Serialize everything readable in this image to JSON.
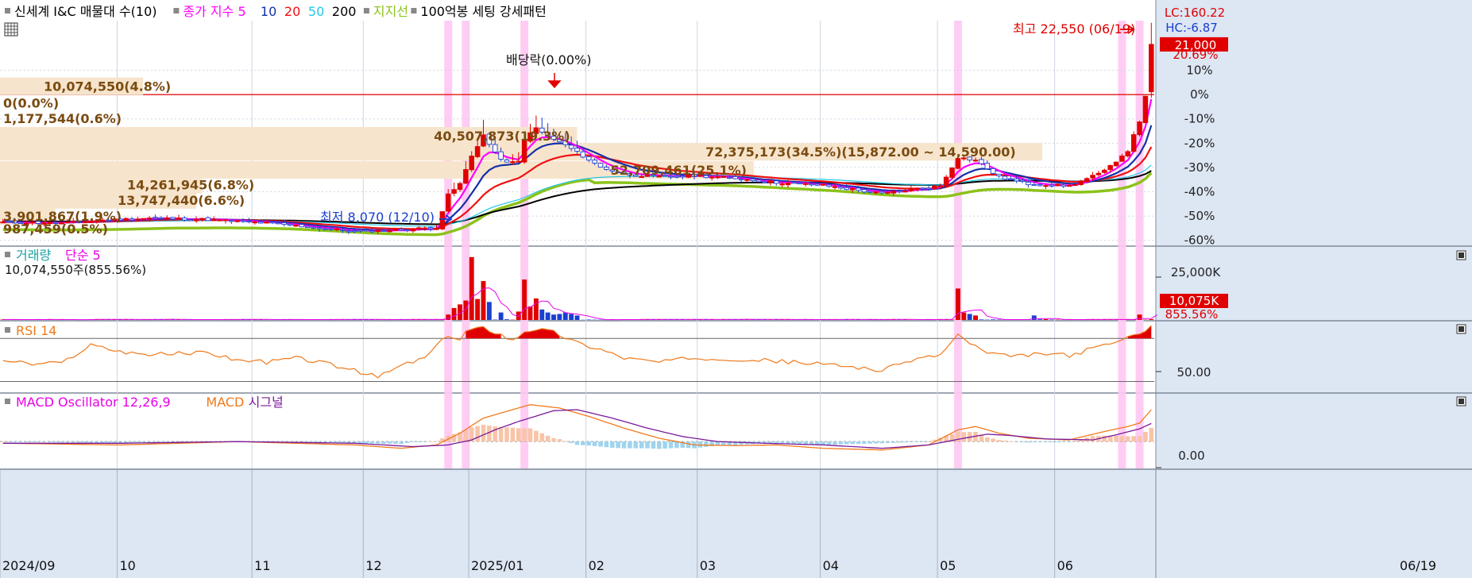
{
  "colors": {
    "background": "#ffffff",
    "axis_panel": "#dde6f3",
    "grid": "#cfd6e2",
    "up": "#e00000",
    "down": "#1a3fd1",
    "ma5": "#ff00ff",
    "ma10": "#1530a8",
    "ma20": "#ee1111",
    "ma50": "#22c8e8",
    "ma200": "#000000",
    "support": "#8cc21a",
    "highlight": "#ffc8f2",
    "band": "#f7e4cc",
    "annotation": "#7a4b10",
    "volume_ma": "#e800e8",
    "rsi": "#f0791a",
    "macd": "#f0791a",
    "signal": "#7a1a9a",
    "osc_pos": "#f8c4a8",
    "osc_neg": "#9fd4ee"
  },
  "header": {
    "grid_icon": "grid-icon",
    "items": [
      {
        "text": "신세계 I&C 매물대 수(10)",
        "color": "#000000"
      },
      {
        "text": "종가 지수 5",
        "color": "#ff00ff"
      },
      {
        "text": "10",
        "color": "#1530a8"
      },
      {
        "text": "20",
        "color": "#ee1111"
      },
      {
        "text": "50",
        "color": "#22c8e8"
      },
      {
        "text": "200",
        "color": "#000000"
      },
      {
        "text": "지지선",
        "color": "#8cc21a"
      },
      {
        "text": "100억봉 세팅 강세패턴",
        "color": "#000000"
      }
    ]
  },
  "price_panel": {
    "lc_label": "LC:160.22",
    "hc_label": "HC:-6.87",
    "current_price_label": "21,000",
    "current_change_label": "20.69%",
    "high_label": "최고 22,550 (06/19)",
    "low_label": "최저 8,070 (12/10)",
    "dividend_label": "배당락(0.00%)",
    "y_ticks": [
      "10%",
      "0%",
      "-10%",
      "-20%",
      "-30%",
      "-40%",
      "-50%",
      "-60%"
    ]
  },
  "volume_profile": [
    {
      "label": "10,074,550(4.8%)",
      "price": 18.0,
      "width": 0.124
    },
    {
      "label": "0(0.0%)",
      "price": 16.8,
      "width": 0.0
    },
    {
      "label": "1,177,544(0.6%)",
      "price": 15.7,
      "width": 0.0
    },
    {
      "label": "40,507,873(19.3%)",
      "price": 14.45,
      "width": 0.5
    },
    {
      "label": "72,375,173(34.5%)(15,872.00 ~ 14,590.00)",
      "price": 13.3,
      "width": 0.903
    },
    {
      "label": "52,709,461(25.1%)",
      "price": 12.0,
      "width": 0.653
    },
    {
      "label": "14,261,945(6.8%)",
      "price": 10.95,
      "width": 0.175
    },
    {
      "label": "13,747,440(6.6%)",
      "price": 9.85,
      "width": 0.17
    },
    {
      "label": "3,901,867(1.9%)",
      "price": 8.7,
      "width": 0.048
    },
    {
      "label": "987,459(0.5%)",
      "price": 7.8,
      "width": 0.0
    }
  ],
  "volume_panel": {
    "legend": [
      {
        "text": "거래량",
        "color": "#1aa0a0"
      },
      {
        "text": "단순 5",
        "color": "#e800e8"
      }
    ],
    "info": "10,074,550주(855.56%)",
    "y_tick": "25,000K",
    "current_label": "10,075K",
    "current_pct": "855.56%"
  },
  "rsi_panel": {
    "legend": [
      {
        "text": "RSI 14",
        "color": "#f0791a"
      }
    ],
    "y_tick": "50.00"
  },
  "macd_panel": {
    "legend": [
      {
        "text": "MACD Oscillator 12,26,9",
        "color": "#e800e8"
      },
      {
        "text": "MACD",
        "color": "#f0791a"
      },
      {
        "text": "시그널",
        "color": "#7a1a9a"
      }
    ],
    "y_tick": "0.00"
  },
  "x_axis": {
    "labels": [
      "2024/09",
      "10",
      "11",
      "12",
      "2025/01",
      "02",
      "03",
      "04",
      "05",
      "06"
    ],
    "month_starts": [
      0,
      20,
      43,
      62,
      80,
      100,
      119,
      140,
      160,
      180
    ],
    "right_label": "06/19"
  },
  "chart_data": {
    "type": "candlestick",
    "title": "신세계 I&C",
    "bars": 197,
    "price_range": [
      6.6,
      22.7
    ],
    "base_price": 17.4,
    "last_close": 21000,
    "high": {
      "value": 22550,
      "date": "06/19"
    },
    "low": {
      "value": 8070,
      "date": "12/10"
    },
    "highlight_bars": [
      76,
      79,
      89,
      163,
      191,
      194
    ],
    "price_keypoints": [
      [
        0,
        8.25
      ],
      [
        10,
        8.2
      ],
      [
        17,
        8.4
      ],
      [
        25,
        8.55
      ],
      [
        35,
        8.45
      ],
      [
        45,
        8.2
      ],
      [
        55,
        7.8
      ],
      [
        60,
        7.6
      ],
      [
        68,
        7.7
      ],
      [
        74,
        7.9
      ],
      [
        76,
        10.2
      ],
      [
        78,
        11.0
      ],
      [
        80,
        13.0
      ],
      [
        82,
        14.5
      ],
      [
        84,
        13.2
      ],
      [
        86,
        12.5
      ],
      [
        88,
        12.6
      ],
      [
        89,
        14.2
      ],
      [
        91,
        15.0
      ],
      [
        93,
        14.4
      ],
      [
        96,
        13.8
      ],
      [
        99,
        13.0
      ],
      [
        102,
        12.2
      ],
      [
        106,
        11.7
      ],
      [
        112,
        11.5
      ],
      [
        118,
        11.6
      ],
      [
        125,
        11.4
      ],
      [
        132,
        11.1
      ],
      [
        140,
        10.9
      ],
      [
        150,
        10.3
      ],
      [
        155,
        10.6
      ],
      [
        160,
        10.85
      ],
      [
        163,
        12.9
      ],
      [
        166,
        12.7
      ],
      [
        170,
        11.5
      ],
      [
        175,
        11.0
      ],
      [
        182,
        10.85
      ],
      [
        188,
        11.9
      ],
      [
        192,
        13.4
      ],
      [
        194,
        15.5
      ],
      [
        197,
        21.0
      ]
    ],
    "volume_spikes": [
      [
        76,
        1800
      ],
      [
        77,
        4000
      ],
      [
        78,
        5200
      ],
      [
        79,
        6500
      ],
      [
        80,
        21000
      ],
      [
        81,
        7000
      ],
      [
        82,
        13000
      ],
      [
        83,
        6000
      ],
      [
        85,
        2500
      ],
      [
        88,
        2800
      ],
      [
        89,
        13500
      ],
      [
        90,
        4500
      ],
      [
        91,
        7200
      ],
      [
        92,
        3500
      ],
      [
        93,
        2500
      ],
      [
        94,
        1800
      ],
      [
        95,
        2000
      ],
      [
        96,
        2500
      ],
      [
        97,
        2000
      ],
      [
        98,
        1500
      ],
      [
        163,
        10500
      ],
      [
        164,
        2500
      ],
      [
        165,
        2000
      ],
      [
        166,
        1500
      ],
      [
        176,
        1500
      ],
      [
        194,
        1800
      ],
      [
        197,
        6000
      ]
    ],
    "volume_range": [
      0,
      22000
    ],
    "rsi_range": [
      20,
      85
    ],
    "rsi_keypoints": [
      [
        0,
        50
      ],
      [
        5,
        46
      ],
      [
        10,
        47
      ],
      [
        15,
        64
      ],
      [
        20,
        58
      ],
      [
        25,
        55
      ],
      [
        30,
        56
      ],
      [
        35,
        57
      ],
      [
        40,
        50
      ],
      [
        45,
        48
      ],
      [
        50,
        52
      ],
      [
        55,
        47
      ],
      [
        60,
        40
      ],
      [
        64,
        34
      ],
      [
        68,
        45
      ],
      [
        72,
        52
      ],
      [
        76,
        73
      ],
      [
        78,
        68
      ],
      [
        79,
        77
      ],
      [
        82,
        80
      ],
      [
        85,
        74
      ],
      [
        87,
        68
      ],
      [
        89,
        77
      ],
      [
        91,
        79
      ],
      [
        94,
        76
      ],
      [
        98,
        66
      ],
      [
        102,
        60
      ],
      [
        106,
        52
      ],
      [
        112,
        48
      ],
      [
        118,
        52
      ],
      [
        125,
        51
      ],
      [
        132,
        49
      ],
      [
        140,
        46
      ],
      [
        145,
        44
      ],
      [
        150,
        40
      ],
      [
        155,
        50
      ],
      [
        160,
        55
      ],
      [
        163,
        73
      ],
      [
        165,
        66
      ],
      [
        168,
        56
      ],
      [
        172,
        53
      ],
      [
        178,
        56
      ],
      [
        182,
        54
      ],
      [
        188,
        64
      ],
      [
        192,
        70
      ],
      [
        194,
        76
      ],
      [
        197,
        84
      ]
    ],
    "macd_range": [
      -0.8,
      1.4
    ],
    "macd_keypoints": [
      [
        0,
        -0.05
      ],
      [
        20,
        -0.1
      ],
      [
        40,
        0.0
      ],
      [
        60,
        -0.1
      ],
      [
        68,
        -0.2
      ],
      [
        74,
        -0.1
      ],
      [
        78,
        0.25
      ],
      [
        82,
        0.7
      ],
      [
        86,
        0.9
      ],
      [
        90,
        1.1
      ],
      [
        95,
        1.0
      ],
      [
        100,
        0.75
      ],
      [
        106,
        0.4
      ],
      [
        112,
        0.1
      ],
      [
        118,
        -0.1
      ],
      [
        125,
        -0.12
      ],
      [
        132,
        -0.1
      ],
      [
        140,
        -0.2
      ],
      [
        150,
        -0.25
      ],
      [
        158,
        -0.1
      ],
      [
        163,
        0.35
      ],
      [
        166,
        0.45
      ],
      [
        170,
        0.25
      ],
      [
        175,
        0.1
      ],
      [
        182,
        0.05
      ],
      [
        188,
        0.3
      ],
      [
        192,
        0.45
      ],
      [
        194,
        0.55
      ],
      [
        197,
        1.15
      ]
    ],
    "signal_keypoints": [
      [
        0,
        -0.05
      ],
      [
        20,
        -0.05
      ],
      [
        40,
        0.0
      ],
      [
        60,
        -0.05
      ],
      [
        70,
        -0.15
      ],
      [
        76,
        -0.1
      ],
      [
        80,
        0.05
      ],
      [
        84,
        0.35
      ],
      [
        88,
        0.6
      ],
      [
        94,
        0.92
      ],
      [
        98,
        0.95
      ],
      [
        104,
        0.7
      ],
      [
        110,
        0.4
      ],
      [
        116,
        0.15
      ],
      [
        122,
        0.0
      ],
      [
        130,
        -0.05
      ],
      [
        140,
        -0.1
      ],
      [
        150,
        -0.2
      ],
      [
        158,
        -0.1
      ],
      [
        164,
        0.1
      ],
      [
        168,
        0.22
      ],
      [
        172,
        0.18
      ],
      [
        178,
        0.08
      ],
      [
        186,
        0.05
      ],
      [
        190,
        0.2
      ],
      [
        194,
        0.38
      ],
      [
        197,
        0.62
      ]
    ]
  }
}
